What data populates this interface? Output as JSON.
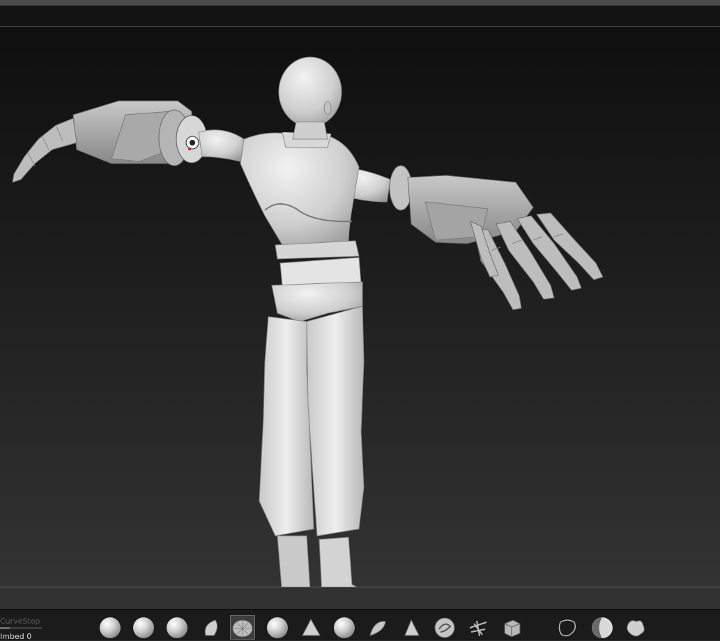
{
  "toolbar": {
    "curve_step_label": "CurveStep",
    "embed_label": "Imbed",
    "embed_value": "0",
    "brushes": [
      {
        "icon": "standard-sphere-icon"
      },
      {
        "icon": "clay-buildup-icon"
      },
      {
        "icon": "clay-tubes-icon"
      },
      {
        "icon": "move-icon"
      },
      {
        "icon": "imm-mesh-icon"
      },
      {
        "icon": "damstandard-icon"
      },
      {
        "icon": "inflate-icon"
      },
      {
        "icon": "smooth-icon"
      },
      {
        "icon": "pinch-icon"
      },
      {
        "icon": "trim-dynamic-icon"
      },
      {
        "icon": "snakehook-icon"
      },
      {
        "icon": "spray-stroke-icon"
      },
      {
        "icon": "cube-insert-icon"
      },
      {
        "icon": "lasso-select-icon"
      },
      {
        "icon": "matcap-material-icon"
      },
      {
        "icon": "texture-alpha-icon"
      }
    ],
    "selected_brush": 4
  },
  "viewport": {
    "model": "t-pose-character-robotic-arms"
  }
}
